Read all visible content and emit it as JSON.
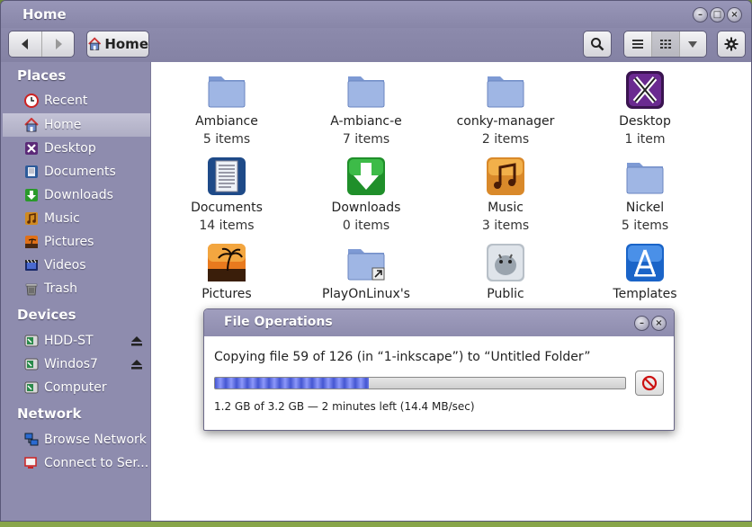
{
  "window": {
    "title": "Home"
  },
  "toolbar": {
    "breadcrumb_label": "Home"
  },
  "sidebar": {
    "places_heading": "Places",
    "places": [
      {
        "label": "Recent",
        "icon": "clock-icon"
      },
      {
        "label": "Home",
        "icon": "home-icon",
        "selected": true
      },
      {
        "label": "Desktop",
        "icon": "desktop-icon"
      },
      {
        "label": "Documents",
        "icon": "documents-icon"
      },
      {
        "label": "Downloads",
        "icon": "downloads-icon"
      },
      {
        "label": "Music",
        "icon": "music-icon"
      },
      {
        "label": "Pictures",
        "icon": "pictures-icon"
      },
      {
        "label": "Videos",
        "icon": "videos-icon"
      },
      {
        "label": "Trash",
        "icon": "trash-icon"
      }
    ],
    "devices_heading": "Devices",
    "devices": [
      {
        "label": "HDD-ST",
        "icon": "drive-icon",
        "ejectable": true
      },
      {
        "label": "Windos7",
        "icon": "drive-icon",
        "ejectable": true
      },
      {
        "label": "Computer",
        "icon": "drive-icon"
      }
    ],
    "network_heading": "Network",
    "network": [
      {
        "label": "Browse Network",
        "icon": "network-icon"
      },
      {
        "label": "Connect to Ser...",
        "icon": "connect-icon"
      }
    ]
  },
  "files": [
    {
      "name": "Ambiance",
      "count": "5 items",
      "icon": "folder-icon"
    },
    {
      "name": "A-mbianc-e",
      "count": "7 items",
      "icon": "folder-icon"
    },
    {
      "name": "conky-manager",
      "count": "2 items",
      "icon": "folder-icon"
    },
    {
      "name": "Desktop",
      "count": "1 item",
      "icon": "desktop-x-icon"
    },
    {
      "name": "Documents",
      "count": "14 items",
      "icon": "documents-folder-icon"
    },
    {
      "name": "Downloads",
      "count": "0 items",
      "icon": "downloads-folder-icon"
    },
    {
      "name": "Music",
      "count": "3 items",
      "icon": "music-folder-icon"
    },
    {
      "name": "Nickel",
      "count": "5 items",
      "icon": "folder-icon"
    },
    {
      "name": "Pictures",
      "count": "",
      "icon": "pictures-folder-icon"
    },
    {
      "name": "PlayOnLinux's",
      "count": "",
      "icon": "link-folder-icon"
    },
    {
      "name": "Public",
      "count": "",
      "icon": "public-folder-icon"
    },
    {
      "name": "Templates",
      "count": "",
      "icon": "templates-folder-icon"
    }
  ],
  "dialog": {
    "title": "File Operations",
    "message": "Copying file 59 of 126 (in “1-inkscape”) to “Untitled Folder”",
    "status": "1.2 GB of 3.2 GB — 2 minutes left (14.4 MB/sec)",
    "progress": 0.375
  },
  "colors": {
    "chrome": "#8e8cae",
    "selected": "#b8b7cc",
    "folder": "#8aa8dc",
    "progress": "#2a3fd0",
    "cancel": "#cc1111"
  }
}
